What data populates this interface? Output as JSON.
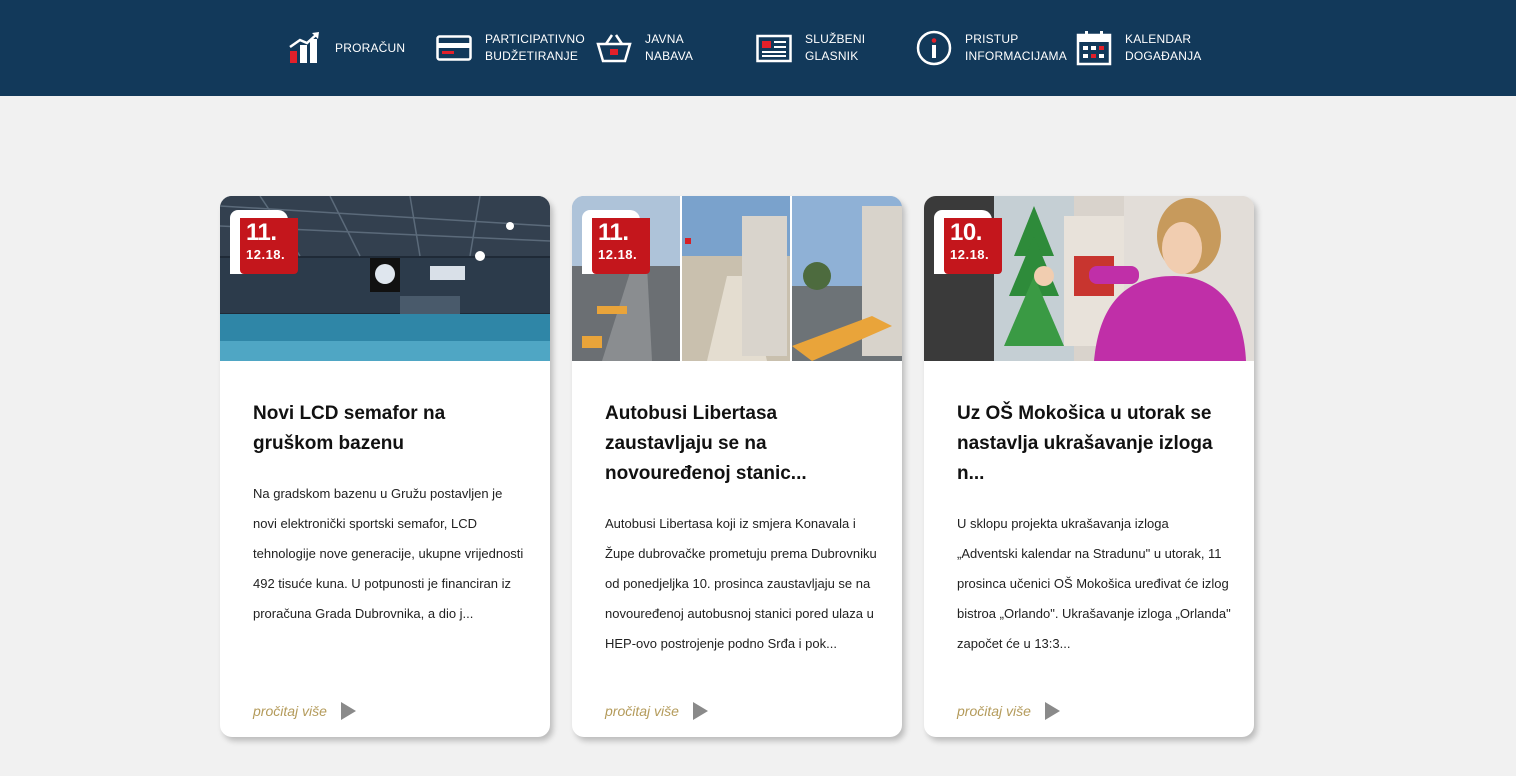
{
  "nav": {
    "items": [
      {
        "id": "proracun",
        "lines": [
          "PRORAČUN"
        ],
        "icon": "bar-chart-icon"
      },
      {
        "id": "participativno",
        "lines": [
          "PARTICIPATIVNO",
          "BUDŽETIRANJE"
        ],
        "icon": "credit-card-icon"
      },
      {
        "id": "javna-nabava",
        "lines": [
          "JAVNA",
          "NABAVA"
        ],
        "icon": "shopping-basket-icon"
      },
      {
        "id": "sluzbeni-glasnik",
        "lines": [
          "SLUŽBENI",
          "GLASNIK"
        ],
        "icon": "newspaper-icon"
      },
      {
        "id": "pristup",
        "lines": [
          "PRISTUP",
          "INFORMACIJAMA"
        ],
        "icon": "info-icon"
      },
      {
        "id": "kalendar",
        "lines": [
          "KALENDAR",
          "DOGAĐANJA"
        ],
        "icon": "calendar-icon"
      }
    ]
  },
  "colors": {
    "header_bg": "#12395a",
    "badge": "#c4161c",
    "read_more": "#b49b5b",
    "page_bg": "#f1f1f1"
  },
  "cards": [
    {
      "day": "11.",
      "month": "12.18.",
      "title": "Novi LCD semafor na gruškom bazenu",
      "excerpt": "Na gradskom bazenu u Gružu postavljen je novi elektronički sportski semafor, LCD tehnologije nove generacije, ukupne vrijednosti  492 tisuće kuna. U potpunosti je financiran iz proračuna Grada Dubrovnika, a dio j...",
      "read_more": "pročitaj više"
    },
    {
      "day": "11.",
      "month": "12.18.",
      "title": "Autobusi Libertasa zaustavljaju se na novouređenoj stanic...",
      "excerpt": "Autobusi Libertasa koji iz smjera Konavala i Župe dubrovačke prometuju prema Dubrovniku od ponedjeljka 10. prosinca zaustavljaju se na novouređenoj autobusnoj stanici pored ulaza u HEP-ovo postrojenje podno Srđa i pok...",
      "read_more": "pročitaj više"
    },
    {
      "day": "10.",
      "month": "12.18.",
      "title": "Uz OŠ Mokošica u utorak se nastavlja ukrašavanje izloga n...",
      "excerpt": "U sklopu projekta ukrašavanja izloga „Adventski  kalendar na Stradunu\" u utorak, 11 prosinca učenici OŠ Mokošica uređivat će izlog bistroa „Orlando\". Ukrašavanje izloga „Orlanda\" započet će u 13:3...",
      "read_more": "pročitaj više"
    }
  ]
}
